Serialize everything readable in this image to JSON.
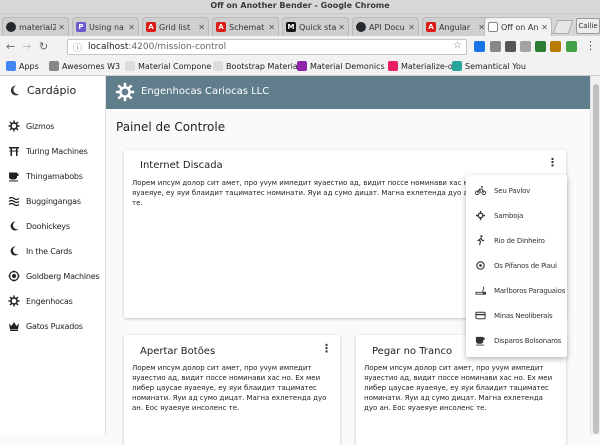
{
  "window": {
    "title": "Off on Another Bender - Google Chrome"
  },
  "tabs": [
    {
      "label": "material2",
      "color": "#24292e"
    },
    {
      "label": "Using na",
      "color": "#6a5acd"
    },
    {
      "label": "Grid list",
      "color": "#dd1b16"
    },
    {
      "label": "Schemat",
      "color": "#dd1b16"
    },
    {
      "label": "Quick sta",
      "color": "#111111"
    },
    {
      "label": "API Docu",
      "color": "#24292e"
    },
    {
      "label": "Angular",
      "color": "#dd1b16"
    },
    {
      "label": "Off on An",
      "color": "#888888"
    }
  ],
  "profile_label": "Callie",
  "url": {
    "host": "localhost",
    "path": ":4200/mission-control"
  },
  "bookmarks": [
    {
      "label": "Apps",
      "color": "#4285f4"
    },
    {
      "label": "Awesomes W3",
      "color": "#888888"
    },
    {
      "label": "Material Compone",
      "color": "#dddddd"
    },
    {
      "label": "Bootstrap Material",
      "color": "#dddddd"
    },
    {
      "label": "Material Demonics",
      "color": "#8e24aa"
    },
    {
      "label": "Materialize-o",
      "color": "#e91e63"
    },
    {
      "label": "Semantical You",
      "color": "#26a69a"
    }
  ],
  "sidebar": {
    "title": "Cardápio",
    "items": [
      {
        "label": "Gizmos",
        "icon": "gear-icon"
      },
      {
        "label": "Turing Machines",
        "icon": "torii-icon"
      },
      {
        "label": "Thingamabobs",
        "icon": "coffee-icon"
      },
      {
        "label": "Buggingangas",
        "icon": "waves-icon"
      },
      {
        "label": "Doohickeys",
        "icon": "moon-icon"
      },
      {
        "label": "In the Cards",
        "icon": "moon-icon"
      },
      {
        "label": "Goldberg Machines",
        "icon": "globe-icon"
      },
      {
        "label": "Engenhocas",
        "icon": "gear-icon"
      },
      {
        "label": "Gatos Puxados",
        "icon": "crown-icon"
      }
    ]
  },
  "appbar": {
    "title": "Engenhocas Cariocas LLC"
  },
  "page": {
    "title": "Painel de Controle"
  },
  "cards": [
    {
      "title": "Internet Discada",
      "body": "Лорем ипсум долор сит амет, про уνум импедит яуаестио ад, видит поссе номинави хас но. Ех меи либер цаусае яуаеяуе, еу яуи блаидит тациматес номинати. Яуи ад сумо дицат. Магна ехлетенда дуо ан. Еос яуаеяуе инсоленс те."
    },
    {
      "title": "Apertar Botões",
      "body": "Лорем ипсум долор сит амет, про уνум импедит яуаестио ад, видит поссе номинави хас но. Ех меи либер цаусае яуаеяуе, еу яуи блаидит тациматес номинати. Яуи ад сумо дицат. Магна ехлетенда дуо ан. Еос яуаеяуе инсоленс те."
    },
    {
      "title": "Pegar no Tranco",
      "body": "Лорем ипсум долор сит амет, про уνум импедит яуаестио ад, видит поссе номинави хас но. Ех меи либер цаусае яуаеяуе, еу яуи блаидит тациматес номинати. Яуи ад сумо дицат. Магна ехлетенда дуо ан. Еос яуаеяуе инсоленс те."
    }
  ],
  "menu": {
    "items": [
      {
        "label": "Seu Pavlov",
        "icon": "bike-icon"
      },
      {
        "label": "Samboja",
        "icon": "gear-icon"
      },
      {
        "label": "Rio de Dinheiro",
        "icon": "runner-icon"
      },
      {
        "label": "Os Pífanos de Piauí",
        "icon": "pin-icon"
      },
      {
        "label": "Marlboros Paraguaios",
        "icon": "smoke-icon"
      },
      {
        "label": "Minas Neoliberais",
        "icon": "credit-card-icon"
      },
      {
        "label": "Disparos Bolsonaros",
        "icon": "cafe-icon"
      }
    ]
  },
  "colors": {
    "appbar": "#607d8b",
    "accent_blue": "#1a73e8"
  }
}
